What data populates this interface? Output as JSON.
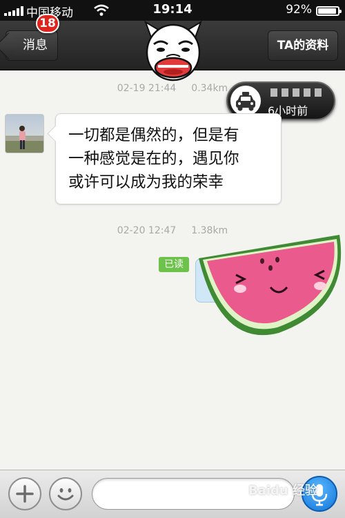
{
  "status_bar": {
    "carrier": "中国移动",
    "time": "19:14",
    "battery_percent": "92%",
    "battery_level": 0.92,
    "signal_bars": 5,
    "wifi_icon": "wifi-icon"
  },
  "nav": {
    "back_label": "消息",
    "unread_badge": "18",
    "profile_label": "TA的资料",
    "face_icon": "cartoon-face-sticker-icon"
  },
  "chat": {
    "messages": [
      {
        "date": "02-19 21:44",
        "distance": "0.34km",
        "text_lines": [
          "一切都是偶然的，但是有",
          "一种感觉是在的，遇见你",
          "或许可以成为我的荣幸"
        ]
      },
      {
        "date": "02-20 12:47",
        "distance": "1.38km",
        "read_status": "已读",
        "sticker": "watermelon-sticker-icon"
      }
    ],
    "taxi_pill": {
      "time_ago": "6小时前",
      "icon": "taxi-icon"
    }
  },
  "bottom": {
    "plus_icon": "plus-icon",
    "emoji_icon": "smiley-icon",
    "input_value": "",
    "mic_icon": "microphone-icon",
    "watermark": "Baidu 经验"
  },
  "colors": {
    "badge": "#e0251c",
    "read_tag": "#6cc24a",
    "mic": "#1273d8",
    "nav_bg": "#2e2e2e"
  }
}
